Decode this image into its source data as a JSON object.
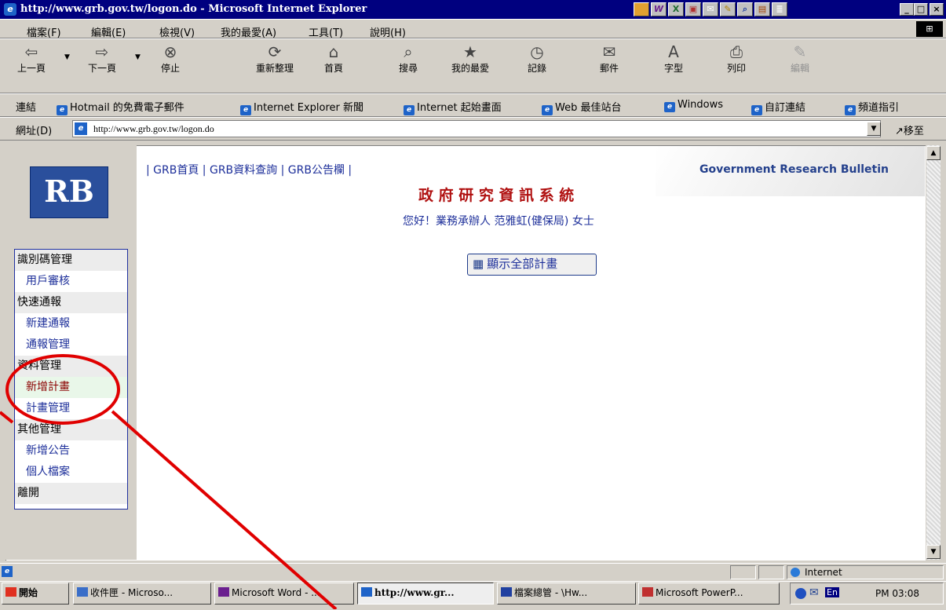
{
  "window": {
    "title": "http://www.grb.gov.tw/logon.do - Microsoft Internet Explorer",
    "min": "_",
    "max": "□",
    "close": "×"
  },
  "menubar": [
    "檔案(F)",
    "編輯(E)",
    "檢視(V)",
    "我的最愛(A)",
    "工具(T)",
    "說明(H)"
  ],
  "toolbar": [
    {
      "label": "上一頁",
      "icon": "⇦"
    },
    {
      "label": "下一頁",
      "icon": "⇨"
    },
    {
      "label": "停止",
      "icon": "⊗"
    },
    {
      "label": "重新整理",
      "icon": "⟳"
    },
    {
      "label": "首頁",
      "icon": "⌂"
    },
    {
      "label": "搜尋",
      "icon": "⌕"
    },
    {
      "label": "我的最愛",
      "icon": "★"
    },
    {
      "label": "記錄",
      "icon": "◷"
    },
    {
      "label": "郵件",
      "icon": "✉"
    },
    {
      "label": "字型",
      "icon": "A"
    },
    {
      "label": "列印",
      "icon": "⎙"
    },
    {
      "label": "編輯",
      "icon": "✎"
    }
  ],
  "links": {
    "label": "連結",
    "items": [
      "Hotmail 的免費電子郵件",
      "Internet Explorer 新聞",
      "Internet 起始畫面",
      "Web 最佳站台",
      "Windows",
      "自訂連結",
      "頻道指引"
    ]
  },
  "address": {
    "label": "網址(D)",
    "value": "http://www.grb.gov.tw/logon.do",
    "go": "移至"
  },
  "page": {
    "logo_text": "RB",
    "topnav": [
      "GRB首頁",
      "GRB資料查詢",
      "GRB公告欄"
    ],
    "brand": "Government Research Bulletin",
    "system_title": "政 府 研 究 資 訊 系 統",
    "greeting": "您好！業務承辦人 范雅虹(健保局) 女士",
    "show_all_button": "顯示全部計畫"
  },
  "sidebar": {
    "sections": [
      {
        "header": "識別碼管理",
        "items": [
          "用戶審核"
        ]
      },
      {
        "header": "快速通報",
        "items": [
          "新建通報",
          "通報管理"
        ]
      },
      {
        "header": "資料管理",
        "items": [
          "新增計畫",
          "計畫管理"
        ]
      },
      {
        "header": "其他管理",
        "items": [
          "新增公告",
          "個人檔案"
        ]
      },
      {
        "header": "離開",
        "items": []
      }
    ]
  },
  "statusbar": {
    "zone": "Internet"
  },
  "taskbar": {
    "start": "開始",
    "tasks": [
      "收件匣 - Microso...",
      "Microsoft Word - ...",
      "http://www.gr...",
      "檔案總管 - \\Hw...",
      "Microsoft PowerP..."
    ],
    "clock": "PM 03:08",
    "ime": "En"
  },
  "colors": {
    "title": "#00007f",
    "system_title": "#b01010",
    "link_blue": "#1d2f9a",
    "annotation": "#e00000"
  }
}
